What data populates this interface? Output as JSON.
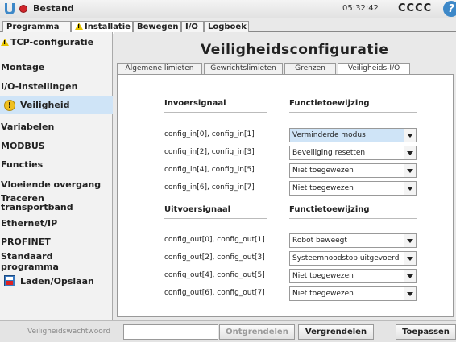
{
  "titlebar": {
    "app_title": "Bestand",
    "clock": "05:32:42",
    "robot_name": "CCCC",
    "help_glyph": "?"
  },
  "main_tabs": [
    {
      "label": "Programma"
    },
    {
      "label": "Installatie",
      "warning": true
    },
    {
      "label": "Bewegen"
    },
    {
      "label": "I/O"
    },
    {
      "label": "Logboek"
    }
  ],
  "sidebar": {
    "items": [
      {
        "label": "TCP-configuratie",
        "icon": "warning-icon"
      },
      {
        "label": "Montage"
      },
      {
        "label": "I/O-instellingen"
      },
      {
        "label": "Veiligheid",
        "icon": "shield-icon",
        "active": true
      },
      {
        "label": "Variabelen"
      },
      {
        "label": "MODBUS"
      },
      {
        "label": "Functies"
      },
      {
        "label": "Vloeiende overgang"
      },
      {
        "label": "Traceren transportband"
      },
      {
        "label": "Ethernet/IP"
      },
      {
        "label": "PROFINET"
      },
      {
        "label": "Standaard programma"
      },
      {
        "label": "Laden/Opslaan",
        "icon": "floppy-icon"
      }
    ]
  },
  "main": {
    "title": "Veiligheidsconfiguratie",
    "sub_tabs": [
      {
        "label": "Algemene limieten"
      },
      {
        "label": "Gewrichtslimieten"
      },
      {
        "label": "Grenzen"
      },
      {
        "label": "Veiligheids-I/O",
        "active": true
      }
    ],
    "input_section": {
      "signal_header": "Invoersignaal",
      "function_header": "Functietoewijzing",
      "rows": [
        {
          "signal": "config_in[0], config_in[1]",
          "value": "Verminderde modus",
          "highlight": true
        },
        {
          "signal": "config_in[2], config_in[3]",
          "value": "Beveiliging resetten"
        },
        {
          "signal": "config_in[4], config_in[5]",
          "value": "Niet toegewezen"
        },
        {
          "signal": "config_in[6], config_in[7]",
          "value": "Niet toegewezen"
        }
      ]
    },
    "output_section": {
      "signal_header": "Uitvoersignaal",
      "function_header": "Functietoewijzing",
      "rows": [
        {
          "signal": "config_out[0], config_out[1]",
          "value": "Robot beweegt"
        },
        {
          "signal": "config_out[2], config_out[3]",
          "value": "Systeemnoodstop uitgevoerd"
        },
        {
          "signal": "config_out[4], config_out[5]",
          "value": "Niet toegewezen"
        },
        {
          "signal": "config_out[6], config_out[7]",
          "value": "Niet toegewezen"
        }
      ]
    }
  },
  "bottombar": {
    "password_label": "Veiligheidswachtwoord",
    "password_value": "",
    "unlock_label": "Ontgrendelen",
    "lock_label": "Vergrendelen",
    "apply_label": "Toepassen"
  },
  "colors": {
    "selection": "#cfe4f7",
    "stop_red": "#d0252b",
    "help_blue": "#3d88c8",
    "warning_yellow": "#e6c300"
  }
}
